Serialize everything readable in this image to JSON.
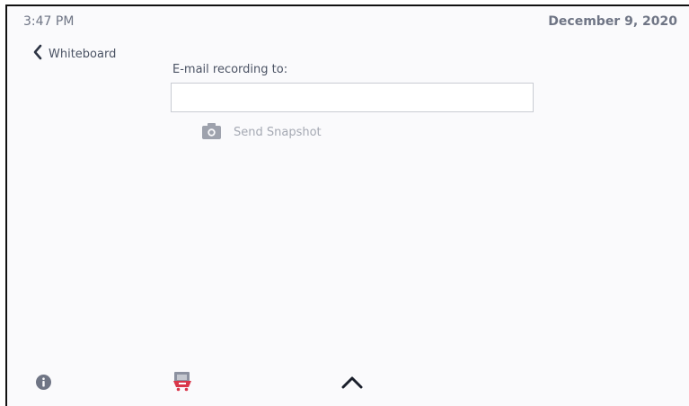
{
  "status_bar": {
    "time": "3:47 PM",
    "date": "December 9, 2020"
  },
  "nav": {
    "back_label": "Whiteboard",
    "back_icon": "chevron-left-icon"
  },
  "form": {
    "email_label": "E-mail recording to:",
    "email_value": "",
    "email_placeholder": ""
  },
  "actions": {
    "snapshot_label": "Send Snapshot",
    "snapshot_icon": "camera-icon"
  },
  "footer": {
    "info_icon": "info-icon",
    "cart_icon": "cart-icon",
    "up_icon": "chevron-up-icon"
  },
  "colors": {
    "background": "#fafafc",
    "text_muted": "#6f7585",
    "text_dark": "#4b5364",
    "icon_gray": "#9ea2ad",
    "accent_red": "#d9374a"
  }
}
